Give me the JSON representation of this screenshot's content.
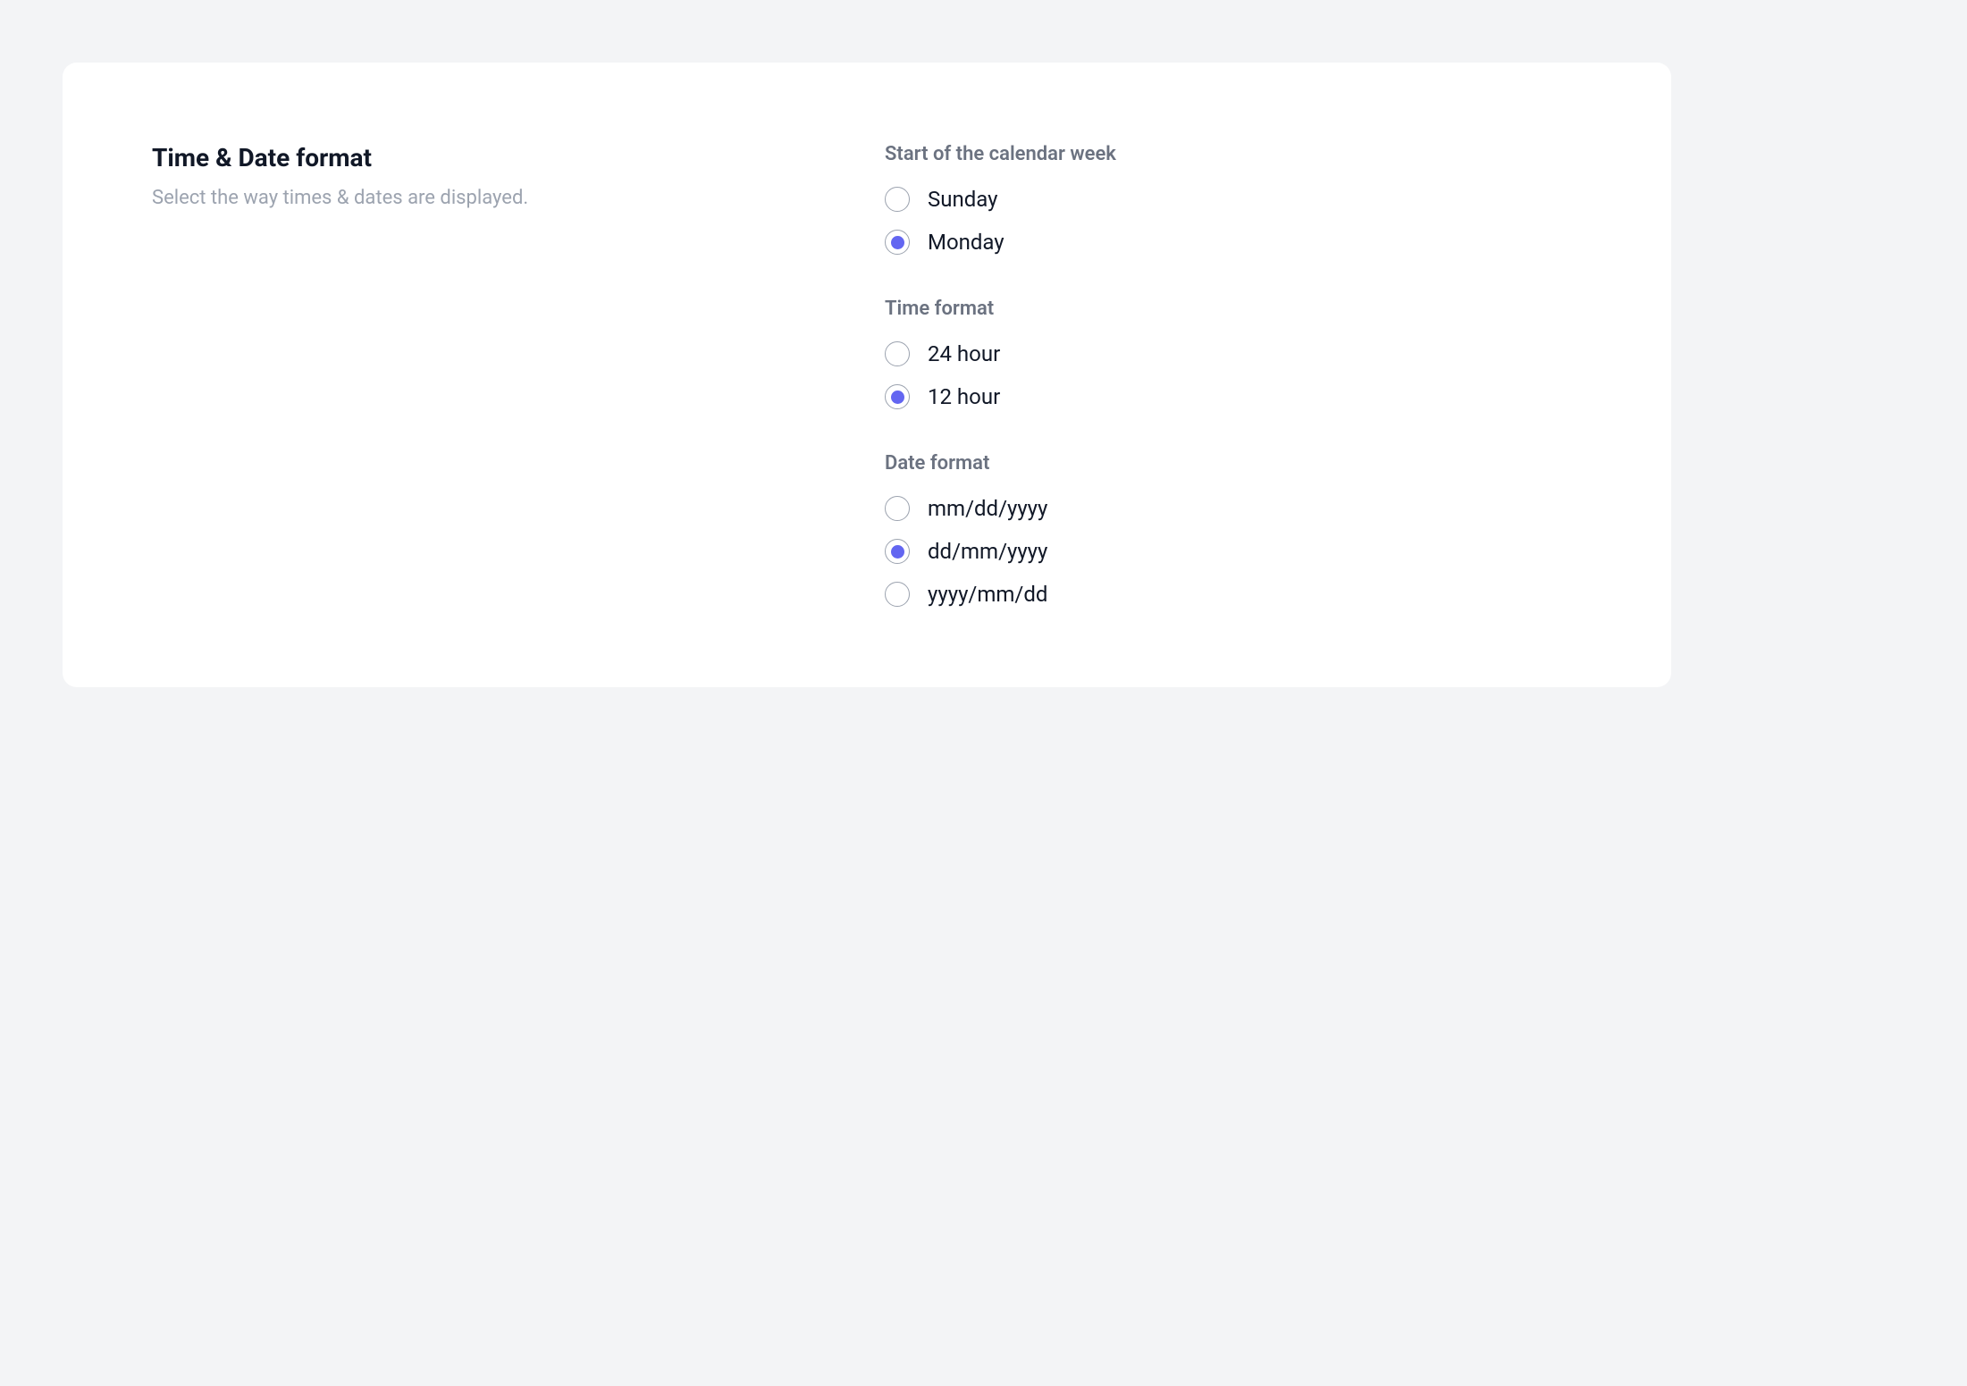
{
  "header": {
    "title": "Time & Date format",
    "description": "Select the way times & dates are displayed."
  },
  "groups": {
    "week_start": {
      "label": "Start of the calendar week",
      "options": [
        {
          "label": "Sunday",
          "selected": false
        },
        {
          "label": "Monday",
          "selected": true
        }
      ]
    },
    "time_format": {
      "label": "Time format",
      "options": [
        {
          "label": "24 hour",
          "selected": false
        },
        {
          "label": "12 hour",
          "selected": true
        }
      ]
    },
    "date_format": {
      "label": "Date format",
      "options": [
        {
          "label": "mm/dd/yyyy",
          "selected": false
        },
        {
          "label": "dd/mm/yyyy",
          "selected": true
        },
        {
          "label": "yyyy/mm/dd",
          "selected": false
        }
      ]
    }
  },
  "colors": {
    "accent": "#6366f1",
    "text_primary": "#111827",
    "text_secondary": "#6b7280",
    "text_muted": "#9ca3af",
    "background": "#f3f4f6",
    "card_background": "#ffffff"
  }
}
